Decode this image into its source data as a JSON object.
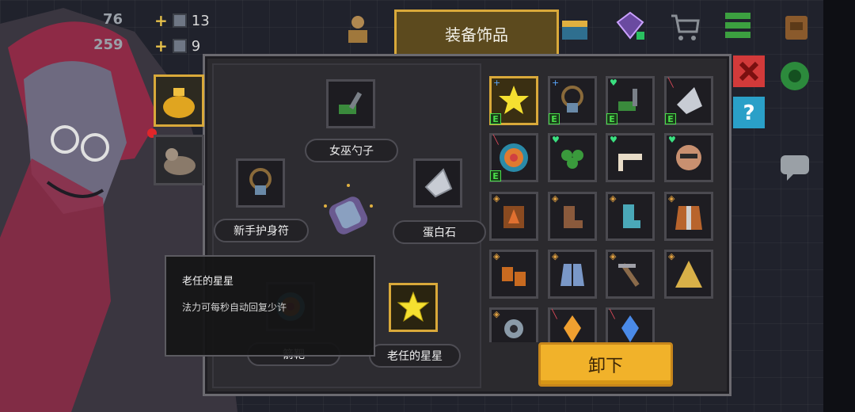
{
  "hud": {
    "stat_top": "76",
    "stat_bottom": "259",
    "res_a_value": "13",
    "res_b_value": "9",
    "plus_sign": "+"
  },
  "title_tab": "装备饰品",
  "equipped": {
    "slot_top_label": "女巫勺子",
    "slot_left_label": "新手护身符",
    "slot_right_label": "蛋白石",
    "slot_bottom_left_label": "箭靶",
    "slot_bottom_right_label": "老任的星星"
  },
  "tooltip": {
    "title": "老任的星星",
    "description": "法力可每秒自动回复少许"
  },
  "inventory": {
    "e_badge": "E",
    "items": [
      {
        "icon": "star-icon",
        "badge": "E",
        "mark": "blue-plus"
      },
      {
        "icon": "amulet-icon",
        "badge": "E",
        "mark": "blue-plus"
      },
      {
        "icon": "spoon-icon",
        "badge": "E",
        "mark": "green-heart"
      },
      {
        "icon": "opal-icon",
        "badge": "E",
        "mark": "red-sword"
      },
      {
        "icon": "target-icon",
        "badge": "E",
        "mark": "red-sword"
      },
      {
        "icon": "clover-icon",
        "badge": "",
        "mark": "green-heart"
      },
      {
        "icon": "bone-icon",
        "badge": "",
        "mark": "green-heart"
      },
      {
        "icon": "face-icon",
        "badge": "",
        "mark": "green-heart"
      },
      {
        "icon": "scroll-icon",
        "badge": "",
        "mark": "orange-shield"
      },
      {
        "icon": "boots-brown-icon",
        "badge": "",
        "mark": "orange-shield"
      },
      {
        "icon": "boots-teal-icon",
        "badge": "",
        "mark": "orange-shield"
      },
      {
        "icon": "vest-icon",
        "badge": "",
        "mark": "orange-shield"
      },
      {
        "icon": "gloves-icon",
        "badge": "",
        "mark": "orange-shield"
      },
      {
        "icon": "boots-blue-icon",
        "badge": "",
        "mark": "orange-shield"
      },
      {
        "icon": "pickaxe-icon",
        "badge": "",
        "mark": "orange-shield"
      },
      {
        "icon": "cloak-icon",
        "badge": "",
        "mark": "orange-shield"
      },
      {
        "icon": "gear-icon",
        "badge": "",
        "mark": "orange-shield"
      },
      {
        "icon": "crystal-orange-icon",
        "badge": "",
        "mark": "red-sword"
      },
      {
        "icon": "crystal-blue-icon",
        "badge": "",
        "mark": "red-sword"
      }
    ]
  },
  "unequip_button": "卸下",
  "colors": {
    "accent_gold": "#d9a93a",
    "button_yellow": "#f1b22a",
    "badge_green": "#49e04a"
  }
}
